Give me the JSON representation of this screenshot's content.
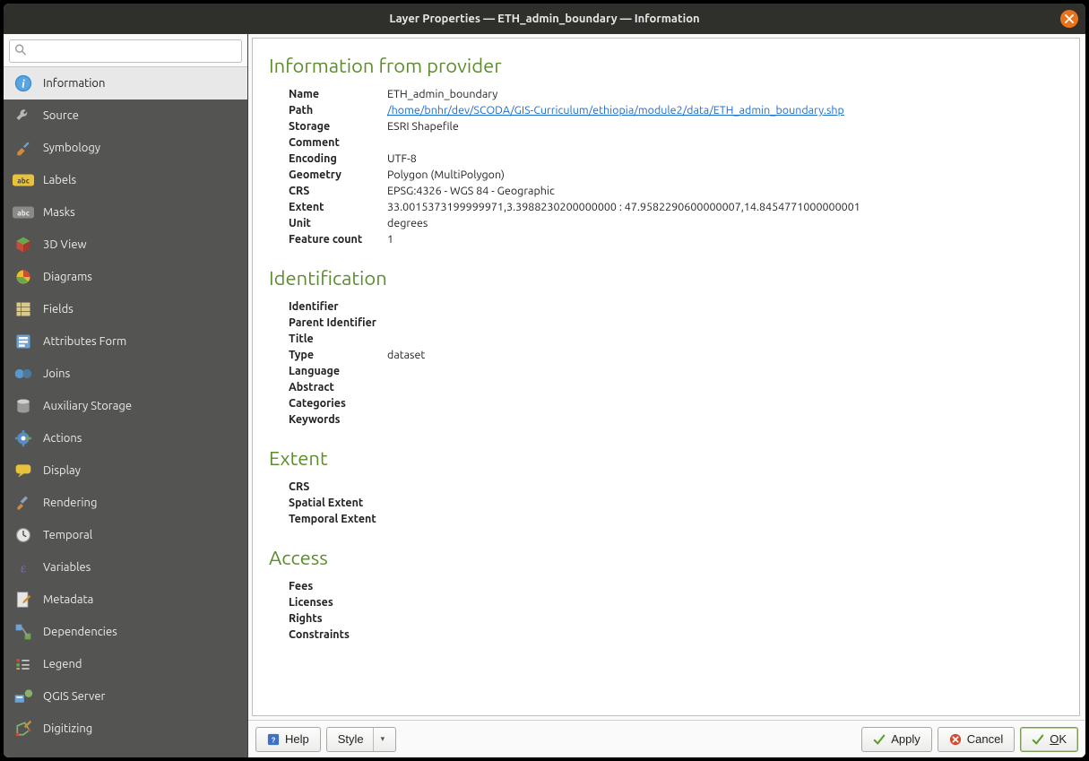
{
  "window": {
    "title": "Layer Properties — ETH_admin_boundary — Information"
  },
  "search": {
    "placeholder": ""
  },
  "sidebar": {
    "items": [
      {
        "id": "information",
        "label": "Information",
        "icon": "info-circle-icon",
        "selected": true
      },
      {
        "id": "source",
        "label": "Source",
        "icon": "wrench-icon",
        "selected": false
      },
      {
        "id": "symbology",
        "label": "Symbology",
        "icon": "paintbrush-icon",
        "selected": false
      },
      {
        "id": "labels",
        "label": "Labels",
        "icon": "label-abc-icon",
        "selected": false
      },
      {
        "id": "masks",
        "label": "Masks",
        "icon": "mask-abc-icon",
        "selected": false
      },
      {
        "id": "3dview",
        "label": "3D View",
        "icon": "cube-icon",
        "selected": false
      },
      {
        "id": "diagrams",
        "label": "Diagrams",
        "icon": "pie-chart-icon",
        "selected": false
      },
      {
        "id": "fields",
        "label": "Fields",
        "icon": "fields-icon",
        "selected": false
      },
      {
        "id": "attributesform",
        "label": "Attributes Form",
        "icon": "form-icon",
        "selected": false
      },
      {
        "id": "joins",
        "label": "Joins",
        "icon": "join-icon",
        "selected": false
      },
      {
        "id": "auxstorage",
        "label": "Auxiliary Storage",
        "icon": "database-icon",
        "selected": false
      },
      {
        "id": "actions",
        "label": "Actions",
        "icon": "gear-run-icon",
        "selected": false
      },
      {
        "id": "display",
        "label": "Display",
        "icon": "tooltip-icon",
        "selected": false
      },
      {
        "id": "rendering",
        "label": "Rendering",
        "icon": "brush-icon",
        "selected": false
      },
      {
        "id": "temporal",
        "label": "Temporal",
        "icon": "clock-icon",
        "selected": false
      },
      {
        "id": "variables",
        "label": "Variables",
        "icon": "epsilon-icon",
        "selected": false
      },
      {
        "id": "metadata",
        "label": "Metadata",
        "icon": "document-edit-icon",
        "selected": false
      },
      {
        "id": "dependencies",
        "label": "Dependencies",
        "icon": "dependencies-icon",
        "selected": false
      },
      {
        "id": "legend",
        "label": "Legend",
        "icon": "legend-icon",
        "selected": false
      },
      {
        "id": "qgisserver",
        "label": "QGIS Server",
        "icon": "server-icon",
        "selected": false
      },
      {
        "id": "digitizing",
        "label": "Digitizing",
        "icon": "digitizing-icon",
        "selected": false
      }
    ]
  },
  "content": {
    "sections": {
      "provider": {
        "heading": "Information from provider",
        "rows": [
          {
            "k": "Name",
            "v": "ETH_admin_boundary"
          },
          {
            "k": "Path",
            "v": "/home/bnhr/dev/SCODA/GIS-Curriculum/ethiopia/module2/data/ETH_admin_boundary.shp",
            "link": true
          },
          {
            "k": "Storage",
            "v": "ESRI Shapefile"
          },
          {
            "k": "Comment",
            "v": ""
          },
          {
            "k": "Encoding",
            "v": "UTF-8"
          },
          {
            "k": "Geometry",
            "v": "Polygon (MultiPolygon)"
          },
          {
            "k": "CRS",
            "v": "EPSG:4326 - WGS 84 - Geographic"
          },
          {
            "k": "Extent",
            "v": "33.0015373199999971,3.3988230200000000 : 47.9582290600000007,14.8454771000000001"
          },
          {
            "k": "Unit",
            "v": "degrees"
          },
          {
            "k": "Feature count",
            "v": "1"
          }
        ]
      },
      "identification": {
        "heading": "Identification",
        "rows": [
          {
            "k": "Identifier",
            "v": ""
          },
          {
            "k": "Parent Identifier",
            "v": ""
          },
          {
            "k": "Title",
            "v": ""
          },
          {
            "k": "Type",
            "v": "dataset"
          },
          {
            "k": "Language",
            "v": ""
          },
          {
            "k": "Abstract",
            "v": ""
          },
          {
            "k": "Categories",
            "v": ""
          },
          {
            "k": "Keywords",
            "v": ""
          }
        ]
      },
      "extent": {
        "heading": "Extent",
        "rows": [
          {
            "k": "CRS",
            "v": ""
          },
          {
            "k": "Spatial Extent",
            "v": ""
          },
          {
            "k": "Temporal Extent",
            "v": ""
          }
        ]
      },
      "access": {
        "heading": "Access",
        "rows": [
          {
            "k": "Fees",
            "v": ""
          },
          {
            "k": "Licenses",
            "v": ""
          },
          {
            "k": "Rights",
            "v": ""
          },
          {
            "k": "Constraints",
            "v": ""
          }
        ]
      }
    }
  },
  "buttons": {
    "help": "Help",
    "style": "Style",
    "apply": "Apply",
    "cancel": "Cancel",
    "ok": "OK"
  }
}
